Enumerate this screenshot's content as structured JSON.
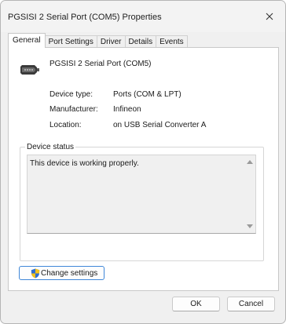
{
  "window": {
    "title": "PGSISI 2 Serial Port (COM5) Properties"
  },
  "tabs": [
    {
      "label": "General",
      "active": true
    },
    {
      "label": "Port Settings",
      "active": false
    },
    {
      "label": "Driver",
      "active": false
    },
    {
      "label": "Details",
      "active": false
    },
    {
      "label": "Events",
      "active": false
    }
  ],
  "device": {
    "icon": "serial-port-connector-icon",
    "name": "PGSISI 2 Serial Port (COM5)",
    "properties": [
      {
        "label": "Device type:",
        "value": "Ports (COM & LPT)"
      },
      {
        "label": "Manufacturer:",
        "value": "Infineon"
      },
      {
        "label": "Location:",
        "value": "on USB Serial Converter A"
      }
    ]
  },
  "status": {
    "legend": "Device status",
    "text": "This device is working properly."
  },
  "buttons": {
    "change_settings": "Change settings",
    "ok": "OK",
    "cancel": "Cancel"
  },
  "colors": {
    "focus_border": "#3f87d8",
    "shield_blue": "#2f6fd1",
    "shield_yellow": "#f2c21b"
  }
}
